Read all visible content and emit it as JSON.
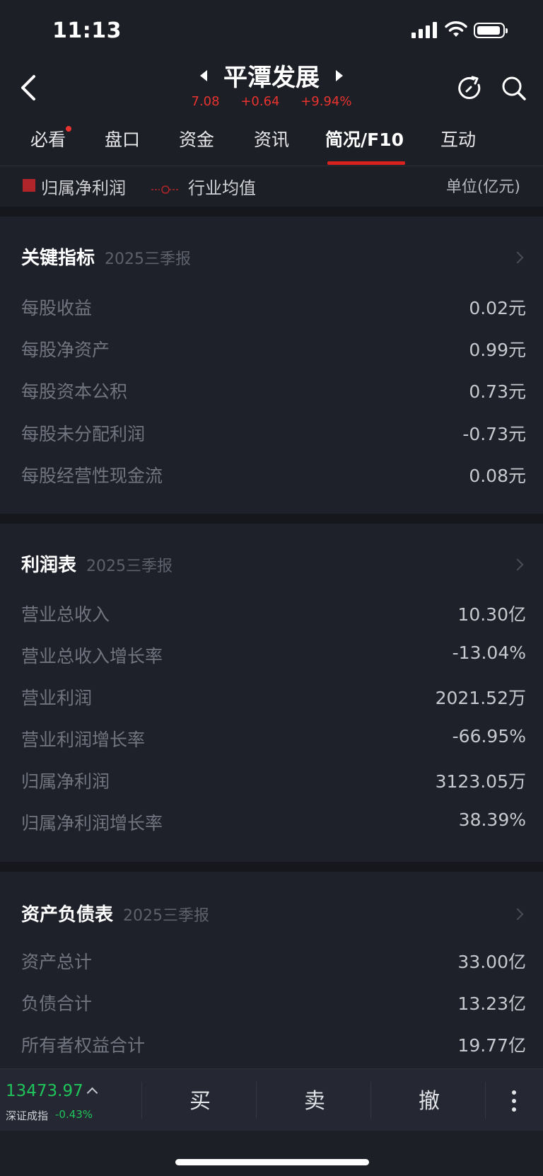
{
  "status": {
    "time": "11:13"
  },
  "header": {
    "title": "平潭发展",
    "price": "7.08",
    "change": "+0.64",
    "change_pct": "+9.94%"
  },
  "tabs": [
    {
      "label": "必看"
    },
    {
      "label": "盘口"
    },
    {
      "label": "资金"
    },
    {
      "label": "资讯"
    },
    {
      "label": "简况/F10"
    },
    {
      "label": "互动"
    }
  ],
  "legend": {
    "series1": "归属净利润",
    "series2": "行业均值",
    "unit": "单位(亿元)"
  },
  "sections": [
    {
      "title": "关键指标",
      "period": "2025三季报",
      "rows": [
        {
          "label": "每股收益",
          "value": "0.02元"
        },
        {
          "label": "每股净资产",
          "value": "0.99元"
        },
        {
          "label": "每股资本公积",
          "value": "0.73元"
        },
        {
          "label": "每股未分配利润",
          "value": "-0.73元"
        },
        {
          "label": "每股经营性现金流",
          "value": "0.08元"
        }
      ]
    },
    {
      "title": "利润表",
      "period": "2025三季报",
      "rows": [
        {
          "label": "营业总收入",
          "value": "10.30亿"
        },
        {
          "label": "营业总收入增长率",
          "value": "-13.04%"
        },
        {
          "label": "营业利润",
          "value": "2021.52万"
        },
        {
          "label": "营业利润增长率",
          "value": "-66.95%"
        },
        {
          "label": "归属净利润",
          "value": "3123.05万"
        },
        {
          "label": "归属净利润增长率",
          "value": "38.39%"
        }
      ]
    },
    {
      "title": "资产负债表",
      "period": "2025三季报",
      "rows": [
        {
          "label": "资产总计",
          "value": "33.00亿"
        },
        {
          "label": "负债合计",
          "value": "13.23亿"
        },
        {
          "label": "所有者权益合计",
          "value": "19.77亿"
        }
      ]
    }
  ],
  "bottom_bar": {
    "index_value": "13473.97",
    "index_name": "深证成指",
    "index_change": "-0.43%",
    "buy": "买",
    "sell": "卖",
    "cancel": "撤"
  },
  "colors": {
    "rise": "#e8332f",
    "fall": "#1fc45a",
    "accent": "#d8221d",
    "background": "#1c1f26"
  }
}
